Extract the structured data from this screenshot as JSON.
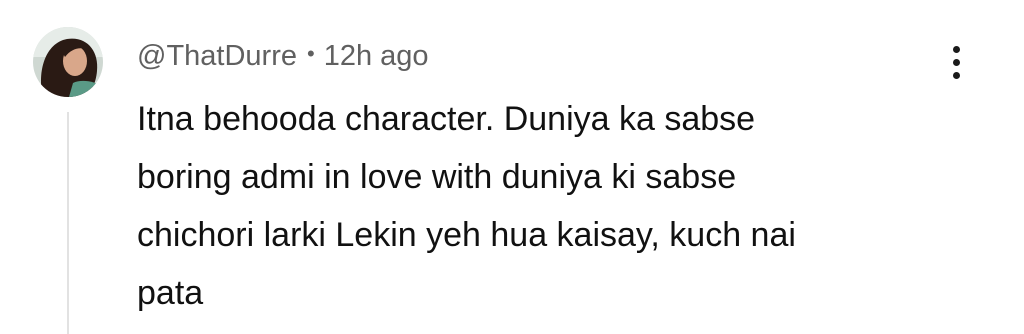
{
  "comment": {
    "author": "@ThatDurre",
    "separator": "•",
    "timestamp": "12h ago",
    "text_lines": [
      "Itna behooda character. Duniya ka sabse",
      "boring admi in love with duniya ki sabse",
      "chichori larki Lekin yeh hua kaisay, kuch nai",
      "pata"
    ],
    "menu_icon": "more-vertical-icon",
    "avatar_icon": "user-avatar"
  },
  "colors": {
    "meta_text": "#606060",
    "body_text": "#111111",
    "thread_line": "#e2e2e2"
  }
}
